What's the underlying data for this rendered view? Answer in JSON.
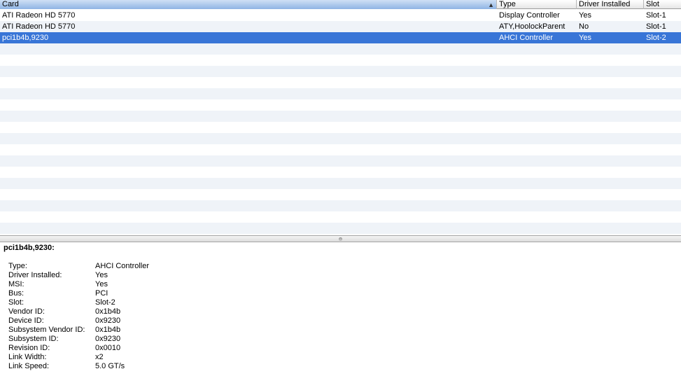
{
  "table": {
    "columns": [
      {
        "key": "card",
        "label": "Card",
        "sorted": true
      },
      {
        "key": "type",
        "label": "Type"
      },
      {
        "key": "driver",
        "label": "Driver Installed"
      },
      {
        "key": "slot",
        "label": "Slot"
      }
    ],
    "sort_indicator": "▲",
    "rows": [
      {
        "card": "ATI Radeon HD 5770",
        "type": "Display Controller",
        "driver": "Yes",
        "slot": "Slot-1"
      },
      {
        "card": "ATI Radeon HD 5770",
        "type": "ATY,HoolockParent",
        "driver": "No",
        "slot": "Slot-1"
      },
      {
        "card": "pci1b4b,9230",
        "type": "AHCI Controller",
        "driver": "Yes",
        "slot": "Slot-2"
      }
    ],
    "selected_index": 2
  },
  "detail": {
    "title": "pci1b4b,9230:",
    "properties": [
      {
        "key": "Type:",
        "value": "AHCI Controller"
      },
      {
        "key": "Driver Installed:",
        "value": "Yes"
      },
      {
        "key": "MSI:",
        "value": "Yes"
      },
      {
        "key": "Bus:",
        "value": "PCI"
      },
      {
        "key": "Slot:",
        "value": "Slot-2"
      },
      {
        "key": "Vendor ID:",
        "value": "0x1b4b"
      },
      {
        "key": "Device ID:",
        "value": "0x9230"
      },
      {
        "key": "Subsystem Vendor ID:",
        "value": "0x1b4b"
      },
      {
        "key": "Subsystem ID:",
        "value": "0x9230"
      },
      {
        "key": "Revision ID:",
        "value": "0x0010"
      },
      {
        "key": "Link Width:",
        "value": "x2"
      },
      {
        "key": "Link Speed:",
        "value": "5.0 GT/s"
      }
    ]
  },
  "colors": {
    "selection": "#3875d7",
    "stripe": "#eff3f8"
  }
}
